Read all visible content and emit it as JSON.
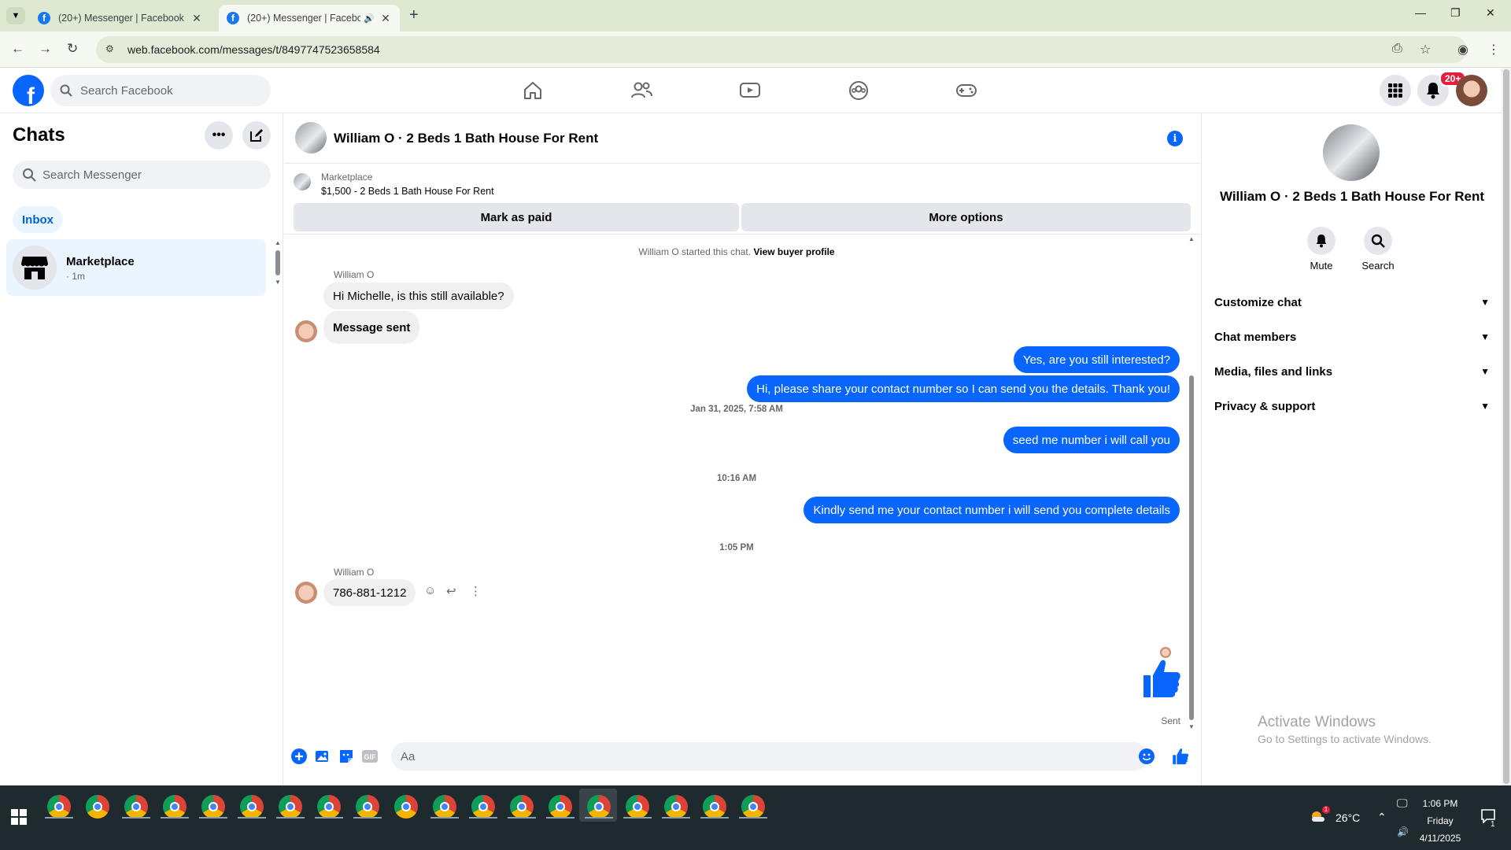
{
  "browser": {
    "tabs": [
      {
        "title": "(20+) Messenger | Facebook",
        "close": "✕"
      },
      {
        "title": "(20+) Messenger | Faceboo",
        "close": "✕"
      }
    ],
    "new_tab": "+",
    "url": "web.facebook.com/messages/t/8497747523658584"
  },
  "fb": {
    "search_placeholder": "Search Facebook",
    "notif_count": "20+"
  },
  "chatlist": {
    "title": "Chats",
    "more": "•••",
    "search_placeholder": "Search Messenger",
    "filter": "Inbox",
    "conversations": [
      {
        "name": "Marketplace",
        "time": "· 1m"
      }
    ]
  },
  "conversation": {
    "title": "William O · 2 Beds 1 Bath House For Rent",
    "marketplace_label": "Marketplace",
    "listing": "$1,500 - 2 Beds 1 Bath House For Rent",
    "mark_paid": "Mark as paid",
    "more_options": "More options",
    "started_text": "William O started this chat.",
    "view_buyer": "View buyer profile",
    "sender_name": "William O",
    "msg_in_1": "Hi Michelle, is this still available?",
    "msg_in_2": "Message sent",
    "msg_out_1": "Yes, are you still interested?",
    "msg_out_2": "Hi, please share your contact number so I can send you the details. Thank you!",
    "ts_1": "Jan 31, 2025, 7:58 AM",
    "msg_out_3": "seed me number i will call you",
    "ts_2": "10:16 AM",
    "msg_out_4": "Kindly send me your contact number i will send you complete details",
    "ts_3": "1:05 PM",
    "msg_in_3": "786-881-1212",
    "sent_status": "Sent",
    "composer_placeholder": "Aa"
  },
  "info_panel": {
    "name": "William O · 2 Beds 1 Bath House For Rent",
    "mute": "Mute",
    "search": "Search",
    "sections": [
      "Customize chat",
      "Chat members",
      "Media, files and links",
      "Privacy & support"
    ]
  },
  "watermark": {
    "line1": "Activate Windows",
    "line2": "Go to Settings to activate Windows."
  },
  "taskbar": {
    "temperature": "26°C",
    "time": "1:06 PM",
    "day": "Friday",
    "date": "4/11/2025",
    "notif_count": "1"
  },
  "colors": {
    "accent": "#0866ff",
    "outgoing_bubble": "#0866ff",
    "incoming_bubble": "#f0f0f0",
    "chrome_frame": "#dfe9d2",
    "taskbar": "#1f2a2e"
  }
}
